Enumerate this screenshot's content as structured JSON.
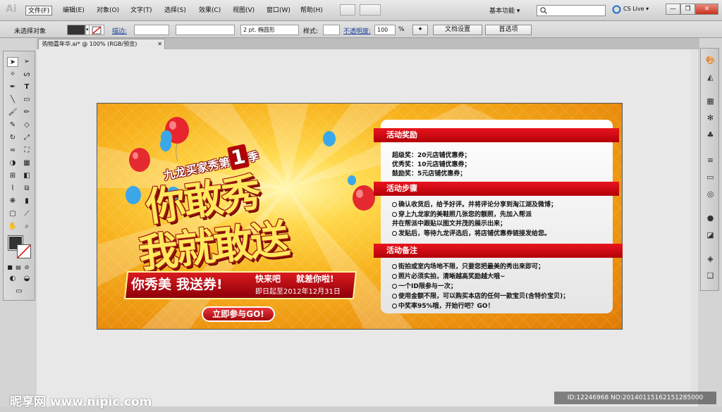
{
  "menubar": {
    "app_logo": "Ai",
    "items": [
      "文件(F)",
      "编辑(E)",
      "对象(O)",
      "文字(T)",
      "选择(S)",
      "效果(C)",
      "视图(V)",
      "窗口(W)",
      "帮助(H)"
    ],
    "workspace": "基本功能 ▾",
    "cs_live": "CS Live ▾",
    "window_controls": [
      "—",
      "❐",
      "✕"
    ]
  },
  "control": {
    "selection": "未选择对象",
    "stroke_label": "描边:",
    "brush": "2 pt. 椭圆形",
    "style_label": "样式:",
    "opacity_label": "不透明度:",
    "opacity_value": "100",
    "percent": "%",
    "doc_settings": "文档设置",
    "preferences": "首选项"
  },
  "document": {
    "tab": "购物嘉年华.ai* @ 100% (RGB/预览)",
    "tab_close": "✕"
  },
  "banner": {
    "small_title": "九龙买家秀第",
    "big_num": "1",
    "small_title_end": "季",
    "main1": "你敢秀",
    "main2": "我就敢送",
    "ribbon_a": "你秀美",
    "ribbon_b": "我送券!",
    "ribbon_c": "快来吧",
    "ribbon_d": "就差你啦!",
    "date": "即日起至2012年12月31日",
    "cta": "立即参与GO!"
  },
  "panel": {
    "sections": [
      {
        "title": "活动奖励",
        "lines": [
          "超级奖：20元店铺优惠券；",
          "优秀奖：10元店铺优惠券；",
          "鼓励奖：5元店铺优惠券；"
        ],
        "bullets": false
      },
      {
        "title": "活动步骤",
        "lines": [
          "确认收货后，给予好评。并将评论分享到淘江湖及微博；",
          "穿上九龙家的美鞋照几张您的靓照，先加入帮派",
          "并在帮派中跟贴以图文并茂的展示出来；",
          "发贴后，等待九龙评选后，将店铺优惠券链接发给您。"
        ],
        "bullets": [
          true,
          true,
          false,
          true
        ]
      },
      {
        "title": "活动备注",
        "lines": [
          "街拍或室内场地不限，只要您把最美的秀出来即可；",
          "照片必须实拍，清晰越高奖励越大哦~",
          "一个ID限参与一次；",
          "使用金额不限，可以购买本店的任何一款宝贝(含特价宝贝)；",
          "中奖率95%哦，开始行吧？GO！"
        ],
        "bullets": [
          true,
          true,
          true,
          true,
          true
        ]
      }
    ]
  },
  "watermark": {
    "left": "昵享网 www.nipic.com",
    "right": "ID:12246968 NO:20140115162151285000"
  }
}
